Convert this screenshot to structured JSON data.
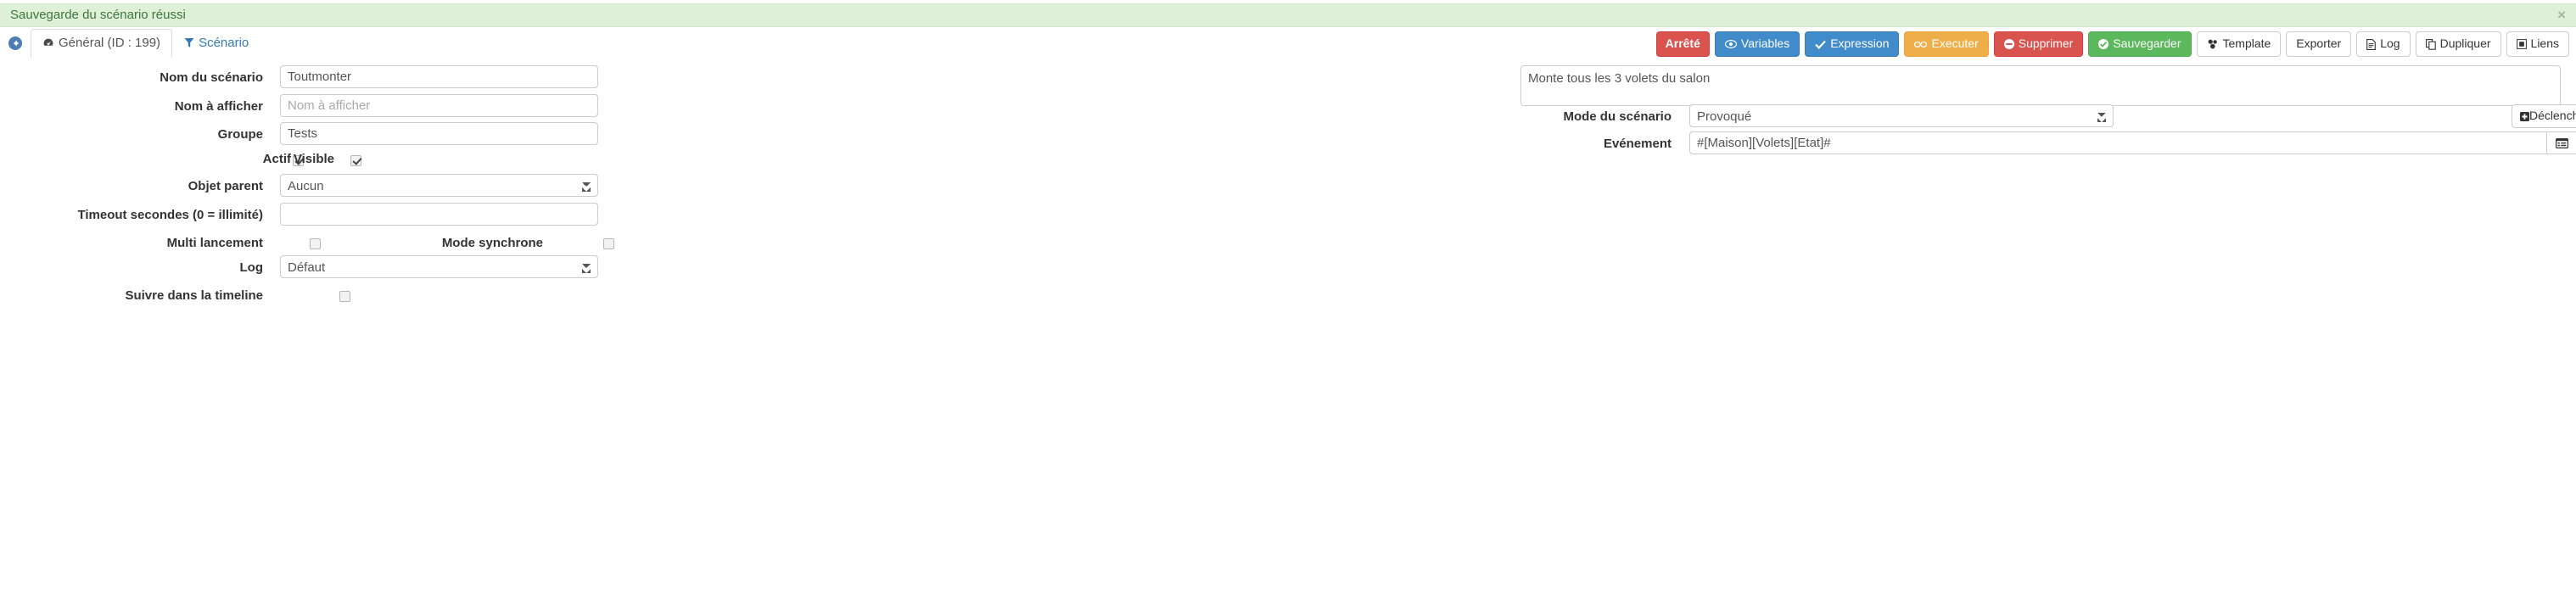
{
  "alert": {
    "message": "Sauvegarde du scénario réussi",
    "close_label": "×",
    "bg_color": "#dff0d8",
    "text_color": "#3c763d"
  },
  "nav": {
    "back_icon": "arrow-circle-left-icon",
    "tabs": [
      {
        "label": "Général (ID : 199)",
        "icon": "dashboard-icon",
        "active": true
      },
      {
        "label": "Scénario",
        "icon": "filter-icon",
        "active": false
      }
    ]
  },
  "toolbar": {
    "status_label": "Arrêté",
    "status_color": "#d9534f",
    "buttons": [
      {
        "label": "Variables",
        "icon": "eye-icon",
        "style": "primary"
      },
      {
        "label": "Expression",
        "icon": "check-icon",
        "style": "primary"
      },
      {
        "label": "Executer",
        "icon": "link-icon",
        "style": "warning"
      },
      {
        "label": "Supprimer",
        "icon": "minus-circle-icon",
        "style": "danger"
      },
      {
        "label": "Sauvegarder",
        "icon": "check-circle-icon",
        "style": "success"
      },
      {
        "label": "Template",
        "icon": "sitemap-icon",
        "style": "default"
      },
      {
        "label": "Exporter",
        "icon": "",
        "style": "default"
      },
      {
        "label": "Log",
        "icon": "file-text-icon",
        "style": "default"
      },
      {
        "label": "Dupliquer",
        "icon": "copy-icon",
        "style": "default"
      },
      {
        "label": "Liens",
        "icon": "link-square-icon",
        "style": "default"
      }
    ]
  },
  "form": {
    "left": {
      "scenario_name": {
        "label": "Nom du scénario",
        "value": "Toutmonter",
        "placeholder": "Nom du scénario"
      },
      "display_name": {
        "label": "Nom à afficher",
        "value": "",
        "placeholder": "Nom à afficher"
      },
      "group": {
        "label": "Groupe",
        "value": "Tests",
        "placeholder": "Groupe"
      },
      "active": {
        "label": "Actif",
        "checked": true
      },
      "visible": {
        "label": "Visible",
        "checked": true
      },
      "parent_object": {
        "label": "Objet parent",
        "value": "Aucun"
      },
      "timeout": {
        "label": "Timeout secondes (0 = illimité)",
        "value": "",
        "placeholder": ""
      },
      "multi_launch": {
        "label": "Multi lancement",
        "checked": false
      },
      "sync_mode": {
        "label": "Mode synchrone",
        "checked": false
      },
      "log": {
        "label": "Log",
        "value": "Défaut"
      },
      "timeline": {
        "label": "Suivre dans la timeline",
        "checked": false
      }
    },
    "right": {
      "description": {
        "value": "Monte tous les 3 volets du salon",
        "placeholder": ""
      },
      "scenario_mode": {
        "label": "Mode du scénario",
        "value": "Provoqué"
      },
      "trigger_button": {
        "label": "Déclencheur",
        "icon": "plus-square-icon"
      },
      "event": {
        "label": "Evénement",
        "value": "#[Maison][Volets][Etat]#",
        "placeholder": ""
      },
      "event_buttons": [
        {
          "icon": "list-alt-icon"
        },
        {
          "icon": "calculator-icon"
        },
        {
          "icon": "minus-circle-icon"
        }
      ]
    }
  }
}
